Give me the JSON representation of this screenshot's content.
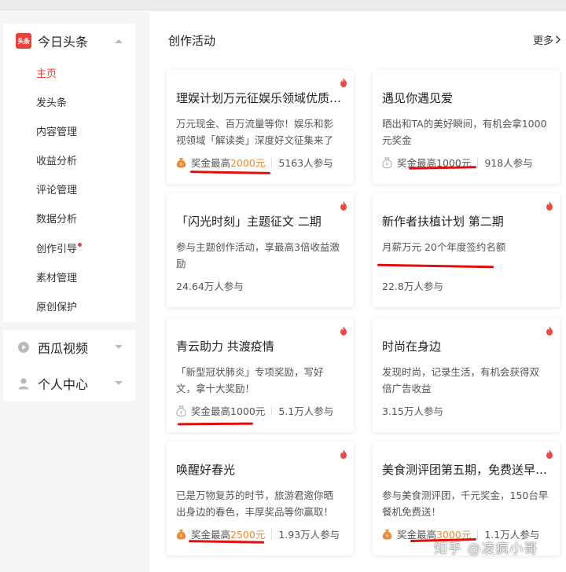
{
  "sidebar": {
    "app": {
      "logo_text": "头条",
      "title": "今日头条"
    },
    "items": [
      {
        "label": "主页",
        "active": true
      },
      {
        "label": "发头条"
      },
      {
        "label": "内容管理"
      },
      {
        "label": "收益分析"
      },
      {
        "label": "评论管理"
      },
      {
        "label": "数据分析"
      },
      {
        "label": "创作引导",
        "dot": true
      },
      {
        "label": "素材管理"
      },
      {
        "label": "原创保护"
      }
    ],
    "sections": [
      {
        "title": "西瓜视频",
        "icon": "play-icon"
      },
      {
        "title": "个人中心",
        "icon": "user-icon"
      }
    ]
  },
  "main": {
    "title": "创作活动",
    "more": "更多",
    "cards": [
      {
        "title": "理娱计划万元征娱乐领域优质…",
        "desc": "万元现金、百万流量等你！娱乐和影视领域「解读类」深度好文征集来了",
        "prize_prefix": "奖金最高",
        "prize_amount": "2000元",
        "participants": "5163人参与"
      },
      {
        "title": "遇见你遇见爱",
        "desc": "晒出和TA的美好瞬间，有机会拿1000元奖金",
        "prize_prefix": "奖金最高",
        "prize_amount": "1000元",
        "participants": "918人参与"
      },
      {
        "title": "「闪光时刻」主题征文 二期",
        "desc": "参与主题创作活动，享最高3倍收益激励",
        "participants": "24.64万人参与"
      },
      {
        "title": "新作者扶植计划 第二期",
        "desc": "月薪万元 20个年度签约名额",
        "participants": "22.8万人参与"
      },
      {
        "title": "青云助力 共渡疫情",
        "desc": "「新型冠状肺炎」专项奖励，写好文，拿十大奖励！",
        "prize_prefix": "奖金最高",
        "prize_amount": "1000元",
        "participants": "5.1万人参与"
      },
      {
        "title": "时尚在身边",
        "desc": "发现时尚，记录生活，有机会获得双倍广告收益",
        "participants": "3.15万人参与"
      },
      {
        "title": "唤醒好春光",
        "desc": "已是万物复苏的时节，旅游君邀你晒出身边的春色，丰厚奖品等你赢取！",
        "prize_prefix": "奖金最高",
        "prize_amount": "2500元",
        "participants": "1.93万人参与"
      },
      {
        "title": "美食测评团第五期，免费送早…",
        "desc": "参与美食测评团，千元奖金，150台早餐机免费送！",
        "prize_prefix": "奖金最高",
        "prize_amount": "3000元",
        "participants": "1.1万人参与"
      }
    ]
  },
  "watermark": "知乎 @凌疯小哥",
  "colors": {
    "accent_red": "#e8423d",
    "prize_orange": "#f08a32",
    "annotation_red": "#e01010"
  }
}
